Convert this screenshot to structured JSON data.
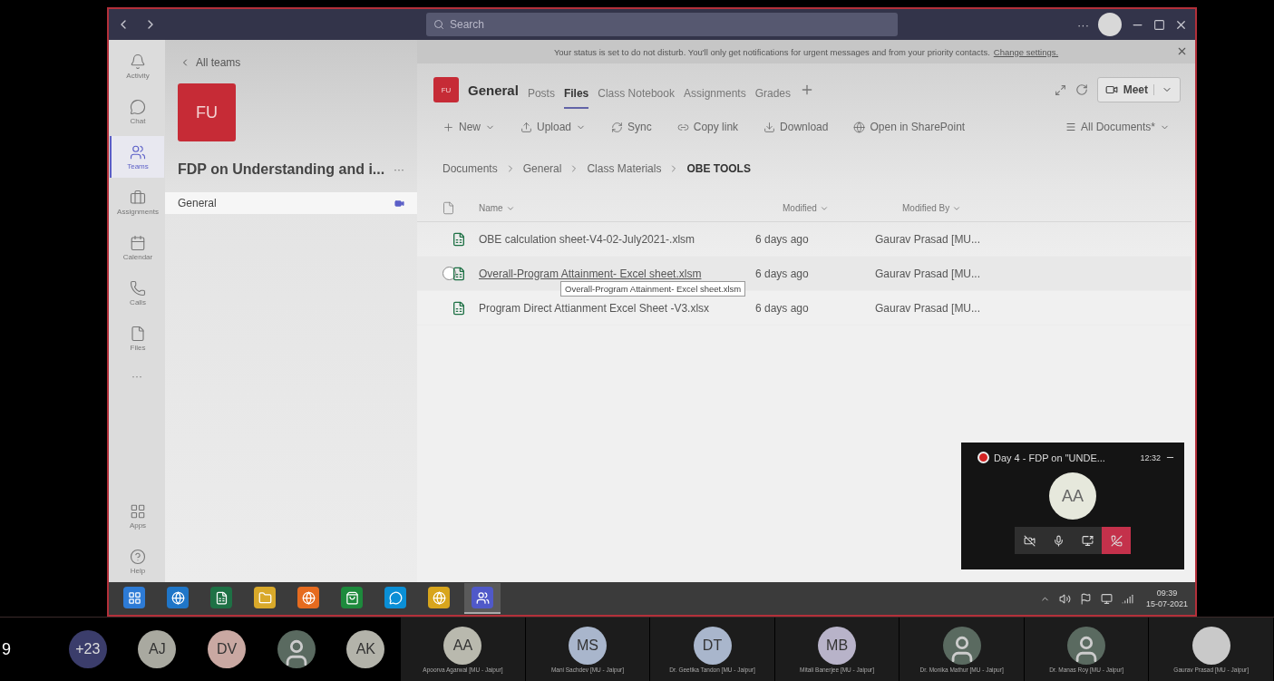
{
  "edge_text": "9",
  "titlebar": {
    "search_placeholder": "Search",
    "more": "···"
  },
  "rail": [
    {
      "kind": "activity",
      "label": "Activity",
      "selected": false
    },
    {
      "kind": "chat",
      "label": "Chat",
      "selected": false
    },
    {
      "kind": "teams",
      "label": "Teams",
      "selected": true
    },
    {
      "kind": "assignments",
      "label": "Assignments",
      "selected": false
    },
    {
      "kind": "calendar",
      "label": "Calendar",
      "selected": false
    },
    {
      "kind": "calls",
      "label": "Calls",
      "selected": false
    },
    {
      "kind": "files",
      "label": "Files",
      "selected": false
    },
    {
      "kind": "more",
      "label": "···"
    }
  ],
  "rail_bottom": [
    {
      "kind": "apps",
      "label": "Apps",
      "selected": false
    },
    {
      "kind": "help",
      "label": "Help",
      "selected": false
    }
  ],
  "team_panel": {
    "back": "All teams",
    "badge": "FU",
    "name": "FDP on Understanding and i...",
    "more": "···",
    "channels": [
      {
        "name": "General",
        "selected": true,
        "meeting": true
      }
    ]
  },
  "banner": {
    "text": "Your status is set to do not disturb. You'll only get notifications for urgent messages and from your priority contacts.",
    "link": "Change settings."
  },
  "channel_header": {
    "badge": "FU",
    "name": "General",
    "meet": "Meet",
    "tabs": [
      {
        "label": "Posts",
        "selected": false
      },
      {
        "label": "Files",
        "selected": true
      },
      {
        "label": "Class Notebook",
        "selected": false
      },
      {
        "label": "Assignments",
        "selected": false
      },
      {
        "label": "Grades",
        "selected": false
      }
    ]
  },
  "toolbar": [
    {
      "kind": "new",
      "label": "New",
      "dropdown": true
    },
    {
      "kind": "upload",
      "label": "Upload",
      "dropdown": true
    },
    {
      "kind": "sync",
      "label": "Sync",
      "dropdown": false
    },
    {
      "kind": "copylink",
      "label": "Copy link",
      "dropdown": false
    },
    {
      "kind": "download",
      "label": "Download",
      "dropdown": false
    },
    {
      "kind": "sharepoint",
      "label": "Open in SharePoint",
      "dropdown": false
    }
  ],
  "view_selector": "All Documents*",
  "breadcrumb": [
    "Documents",
    "General",
    "Class Materials",
    "OBE TOOLS"
  ],
  "table": {
    "columns": [
      "Name",
      "Modified",
      "Modified By"
    ],
    "rows": [
      {
        "name": "OBE calculation sheet-V4-02-July2021-.xlsm",
        "modified": "6 days ago",
        "modified_by": "Gaurav Prasad [MU...",
        "hovered": false
      },
      {
        "name": "Overall-Program Attainment- Excel sheet.xlsm",
        "modified": "6 days ago",
        "modified_by": "Gaurav Prasad [MU...",
        "hovered": true
      },
      {
        "name": "Program Direct Attianment Excel Sheet -V3.xlsx",
        "modified": "6 days ago",
        "modified_by": "Gaurav Prasad [MU...",
        "hovered": false
      }
    ]
  },
  "tooltip": "Overall-Program Attainment- Excel sheet.xlsm",
  "meeting_popup": {
    "recording": true,
    "title": "Day 4 - FDP on \"UNDE...",
    "time": "12:32",
    "avatar": "AA"
  },
  "taskbar": {
    "apps": [
      {
        "kind": "start",
        "active": false
      },
      {
        "kind": "ie",
        "active": false
      },
      {
        "kind": "excel",
        "active": false
      },
      {
        "kind": "folder",
        "active": false
      },
      {
        "kind": "firefox",
        "active": false
      },
      {
        "kind": "store",
        "active": false
      },
      {
        "kind": "skype",
        "active": false
      },
      {
        "kind": "chrome",
        "active": false
      },
      {
        "kind": "teams",
        "active": true
      }
    ],
    "time": "09:39",
    "date": "15-07-2021"
  },
  "participants": [
    {
      "kind": "initials",
      "initials": "+23",
      "color": "#3b3d6b"
    },
    {
      "kind": "initials",
      "initials": "AJ",
      "color": "#a9a9a0"
    },
    {
      "kind": "initials",
      "initials": "DV",
      "color": "#c9a8a2"
    },
    {
      "kind": "photo"
    },
    {
      "kind": "initials",
      "initials": "AK",
      "color": "#b3b3aa"
    },
    {
      "kind": "initials",
      "initials": "AA",
      "color": "#b9b9ae",
      "name": "Apoorva Agarwal [MU - Jaipur]"
    },
    {
      "kind": "initials",
      "initials": "MS",
      "color": "#a9b6cc",
      "name": "Mani Sachdev [MU - Jaipur]"
    },
    {
      "kind": "initials",
      "initials": "DT",
      "color": "#a9b6cc",
      "name": "Dr. Geetika Tandon [MU - Jaipur]"
    },
    {
      "kind": "initials",
      "initials": "MB",
      "color": "#b8b3c9",
      "name": "Mitali Banerjee [MU - Jaipur]"
    },
    {
      "kind": "photo",
      "name": "Dr. Monika Mathur [MU - Jaipur]"
    },
    {
      "kind": "photo",
      "name": "Dr. Manas Roy [MU - Jaipur]"
    },
    {
      "kind": "initials",
      "color": "#c9c9c9",
      "name": "Gaurav Prasad [MU - Jaipur]"
    }
  ]
}
